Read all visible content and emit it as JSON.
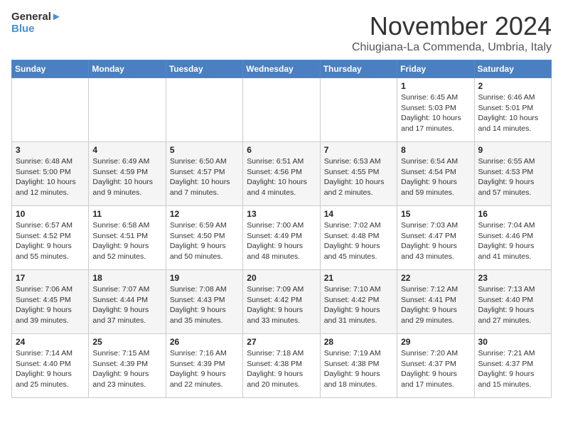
{
  "logo": {
    "line1": "General",
    "line2": "Blue"
  },
  "title": "November 2024",
  "location": "Chiugiana-La Commenda, Umbria, Italy",
  "days_of_week": [
    "Sunday",
    "Monday",
    "Tuesday",
    "Wednesday",
    "Thursday",
    "Friday",
    "Saturday"
  ],
  "weeks": [
    [
      {
        "day": "",
        "info": ""
      },
      {
        "day": "",
        "info": ""
      },
      {
        "day": "",
        "info": ""
      },
      {
        "day": "",
        "info": ""
      },
      {
        "day": "",
        "info": ""
      },
      {
        "day": "1",
        "info": "Sunrise: 6:45 AM\nSunset: 5:03 PM\nDaylight: 10 hours\nand 17 minutes."
      },
      {
        "day": "2",
        "info": "Sunrise: 6:46 AM\nSunset: 5:01 PM\nDaylight: 10 hours\nand 14 minutes."
      }
    ],
    [
      {
        "day": "3",
        "info": "Sunrise: 6:48 AM\nSunset: 5:00 PM\nDaylight: 10 hours\nand 12 minutes."
      },
      {
        "day": "4",
        "info": "Sunrise: 6:49 AM\nSunset: 4:59 PM\nDaylight: 10 hours\nand 9 minutes."
      },
      {
        "day": "5",
        "info": "Sunrise: 6:50 AM\nSunset: 4:57 PM\nDaylight: 10 hours\nand 7 minutes."
      },
      {
        "day": "6",
        "info": "Sunrise: 6:51 AM\nSunset: 4:56 PM\nDaylight: 10 hours\nand 4 minutes."
      },
      {
        "day": "7",
        "info": "Sunrise: 6:53 AM\nSunset: 4:55 PM\nDaylight: 10 hours\nand 2 minutes."
      },
      {
        "day": "8",
        "info": "Sunrise: 6:54 AM\nSunset: 4:54 PM\nDaylight: 9 hours\nand 59 minutes."
      },
      {
        "day": "9",
        "info": "Sunrise: 6:55 AM\nSunset: 4:53 PM\nDaylight: 9 hours\nand 57 minutes."
      }
    ],
    [
      {
        "day": "10",
        "info": "Sunrise: 6:57 AM\nSunset: 4:52 PM\nDaylight: 9 hours\nand 55 minutes."
      },
      {
        "day": "11",
        "info": "Sunrise: 6:58 AM\nSunset: 4:51 PM\nDaylight: 9 hours\nand 52 minutes."
      },
      {
        "day": "12",
        "info": "Sunrise: 6:59 AM\nSunset: 4:50 PM\nDaylight: 9 hours\nand 50 minutes."
      },
      {
        "day": "13",
        "info": "Sunrise: 7:00 AM\nSunset: 4:49 PM\nDaylight: 9 hours\nand 48 minutes."
      },
      {
        "day": "14",
        "info": "Sunrise: 7:02 AM\nSunset: 4:48 PM\nDaylight: 9 hours\nand 45 minutes."
      },
      {
        "day": "15",
        "info": "Sunrise: 7:03 AM\nSunset: 4:47 PM\nDaylight: 9 hours\nand 43 minutes."
      },
      {
        "day": "16",
        "info": "Sunrise: 7:04 AM\nSunset: 4:46 PM\nDaylight: 9 hours\nand 41 minutes."
      }
    ],
    [
      {
        "day": "17",
        "info": "Sunrise: 7:06 AM\nSunset: 4:45 PM\nDaylight: 9 hours\nand 39 minutes."
      },
      {
        "day": "18",
        "info": "Sunrise: 7:07 AM\nSunset: 4:44 PM\nDaylight: 9 hours\nand 37 minutes."
      },
      {
        "day": "19",
        "info": "Sunrise: 7:08 AM\nSunset: 4:43 PM\nDaylight: 9 hours\nand 35 minutes."
      },
      {
        "day": "20",
        "info": "Sunrise: 7:09 AM\nSunset: 4:42 PM\nDaylight: 9 hours\nand 33 minutes."
      },
      {
        "day": "21",
        "info": "Sunrise: 7:10 AM\nSunset: 4:42 PM\nDaylight: 9 hours\nand 31 minutes."
      },
      {
        "day": "22",
        "info": "Sunrise: 7:12 AM\nSunset: 4:41 PM\nDaylight: 9 hours\nand 29 minutes."
      },
      {
        "day": "23",
        "info": "Sunrise: 7:13 AM\nSunset: 4:40 PM\nDaylight: 9 hours\nand 27 minutes."
      }
    ],
    [
      {
        "day": "24",
        "info": "Sunrise: 7:14 AM\nSunset: 4:40 PM\nDaylight: 9 hours\nand 25 minutes."
      },
      {
        "day": "25",
        "info": "Sunrise: 7:15 AM\nSunset: 4:39 PM\nDaylight: 9 hours\nand 23 minutes."
      },
      {
        "day": "26",
        "info": "Sunrise: 7:16 AM\nSunset: 4:39 PM\nDaylight: 9 hours\nand 22 minutes."
      },
      {
        "day": "27",
        "info": "Sunrise: 7:18 AM\nSunset: 4:38 PM\nDaylight: 9 hours\nand 20 minutes."
      },
      {
        "day": "28",
        "info": "Sunrise: 7:19 AM\nSunset: 4:38 PM\nDaylight: 9 hours\nand 18 minutes."
      },
      {
        "day": "29",
        "info": "Sunrise: 7:20 AM\nSunset: 4:37 PM\nDaylight: 9 hours\nand 17 minutes."
      },
      {
        "day": "30",
        "info": "Sunrise: 7:21 AM\nSunset: 4:37 PM\nDaylight: 9 hours\nand 15 minutes."
      }
    ]
  ]
}
